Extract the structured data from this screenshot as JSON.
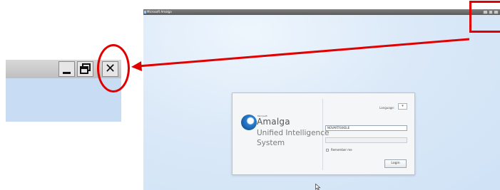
{
  "app_window": {
    "title": "Microsoft Amalga"
  },
  "login": {
    "brand_small": "Microsoft",
    "brand_name": "Amalga",
    "brand_line1": "Unified Intelligence",
    "brand_line2": "System",
    "language_label": "Language:",
    "language_value": "",
    "username_value": "NOVARTIS\\KELE",
    "password_placeholder": "",
    "remember_label": "Remember me",
    "login_button": "Login"
  },
  "zoom": {
    "minimize_icon": "minimize-icon",
    "restore_icon": "restore-icon",
    "close_glyph": "✕"
  },
  "colors": {
    "highlight": "#e00000",
    "desktop": "#d9e8f7"
  }
}
